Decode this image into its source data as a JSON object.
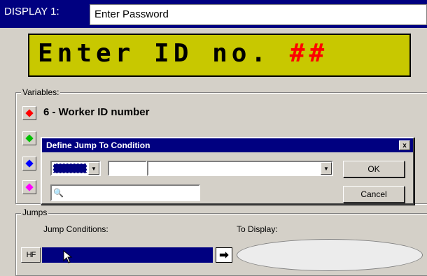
{
  "window": {
    "title_label": "DISPLAY 1:",
    "title_value": "Enter Password"
  },
  "lcd": {
    "text": "Enter ID no. ",
    "hash": "##",
    "bg_color": "#c8c800",
    "hash_color": "#ff0000"
  },
  "variables": {
    "legend": "Variables:",
    "label": "6 - Worker ID number",
    "buttons": [
      {
        "icon": "red-diamond-icon",
        "color": "#ff0000"
      },
      {
        "icon": "green-diamond-icon",
        "color": "#00c000"
      },
      {
        "icon": "blue-diamond-icon",
        "color": "#0000ff"
      },
      {
        "icon": "magenta-diamond-icon",
        "color": "#ff00ff"
      }
    ]
  },
  "dialog": {
    "title": "Define Jump To Condition",
    "close": "x",
    "ok_label": "OK",
    "cancel_label": "Cancel",
    "number_value": "",
    "main_value": "",
    "search_value": ""
  },
  "jumps": {
    "legend": "Jumps",
    "conditions_label": "Jump Conditions:",
    "display_label": "To Display:",
    "jump_button": "HF",
    "arrow": "➡"
  }
}
